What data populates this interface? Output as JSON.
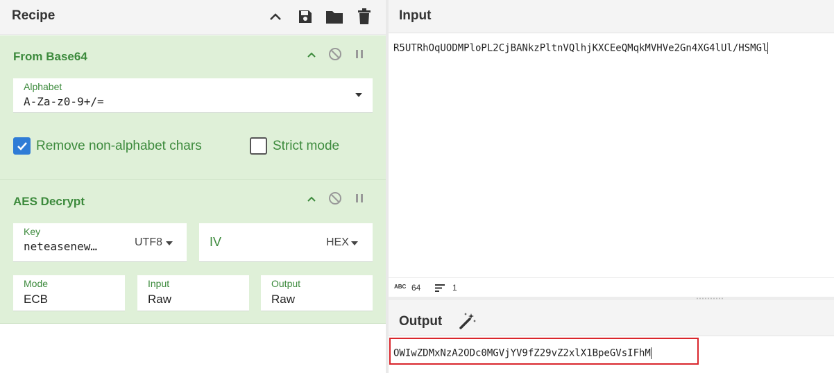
{
  "recipe": {
    "title": "Recipe",
    "operations": [
      {
        "title": "From Base64",
        "alphabet": {
          "label": "Alphabet",
          "value": "A-Za-z0-9+/="
        },
        "remove_non_alphabet": {
          "label": "Remove non-alphabet chars",
          "checked": true
        },
        "strict_mode": {
          "label": "Strict mode",
          "checked": false
        }
      },
      {
        "title": "AES Decrypt",
        "key": {
          "label": "Key",
          "value": "neteasenew…",
          "encoding": "UTF8"
        },
        "iv": {
          "label": "IV",
          "value": "",
          "encoding": "HEX"
        },
        "mode": {
          "label": "Mode",
          "value": "ECB"
        },
        "input": {
          "label": "Input",
          "value": "Raw"
        },
        "output": {
          "label": "Output",
          "value": "Raw"
        }
      }
    ]
  },
  "input": {
    "title": "Input",
    "text": "R5UTRhOqUODMPloPL2CjBANkzPltnVQlhjKXCEeQMqkMVHVe2Gn4XG4lUl/HSMGl",
    "status": {
      "length": "64",
      "lines": "1",
      "length_icon": "ABC"
    }
  },
  "output": {
    "title": "Output",
    "text": "OWIwZDMxNzA2ODc0MGVjYV9fZ29vZ2xlX1BpeGVsIFhM",
    "highlight_color": "#d9262c"
  },
  "colors": {
    "accent": "#3c8a3c",
    "op_bg": "#dff0d8",
    "checkbox": "#2f7cd6"
  }
}
